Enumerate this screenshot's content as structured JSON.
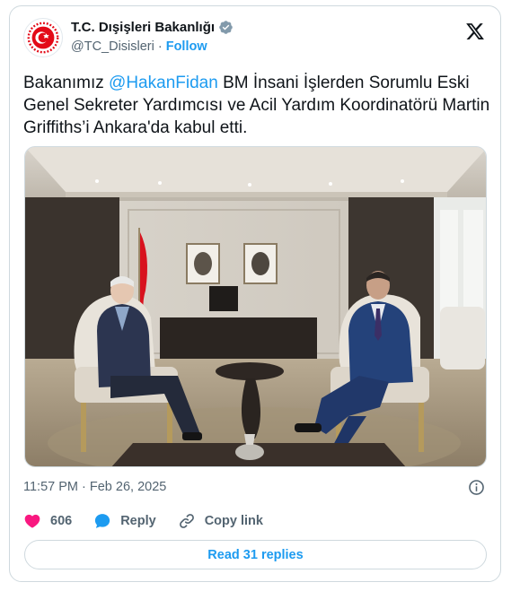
{
  "account": {
    "display_name": "T.C. Dışişleri Bakanlığı",
    "handle": "@TC_Disisleri",
    "separator": "·",
    "follow_label": "Follow",
    "verified_color": "#829aab"
  },
  "tweet": {
    "text_before": "Bakanımız ",
    "mention": "@HakanFidan",
    "text_after": " BM İnsani İşlerden Sorumlu Eski Genel Sekreter Yardımcısı ve Acil Yardım Koordinatörü Martin Griffiths’i Ankara'da kabul etti.",
    "timestamp": "11:57 PM · Feb 26, 2025"
  },
  "actions": {
    "likes_count": "606",
    "reply_label": "Reply",
    "copy_link_label": "Copy link"
  },
  "footer": {
    "read_replies_label": "Read 31 replies"
  },
  "colors": {
    "accent": "#1d9bf0",
    "like": "#f91880",
    "muted": "#536471",
    "flag_red": "#e30a17"
  },
  "icons": {
    "verified": "verified-badge-icon",
    "x_logo": "x-logo-icon",
    "info": "info-icon",
    "heart": "heart-icon",
    "reply": "reply-bubble-icon",
    "link": "link-icon"
  }
}
